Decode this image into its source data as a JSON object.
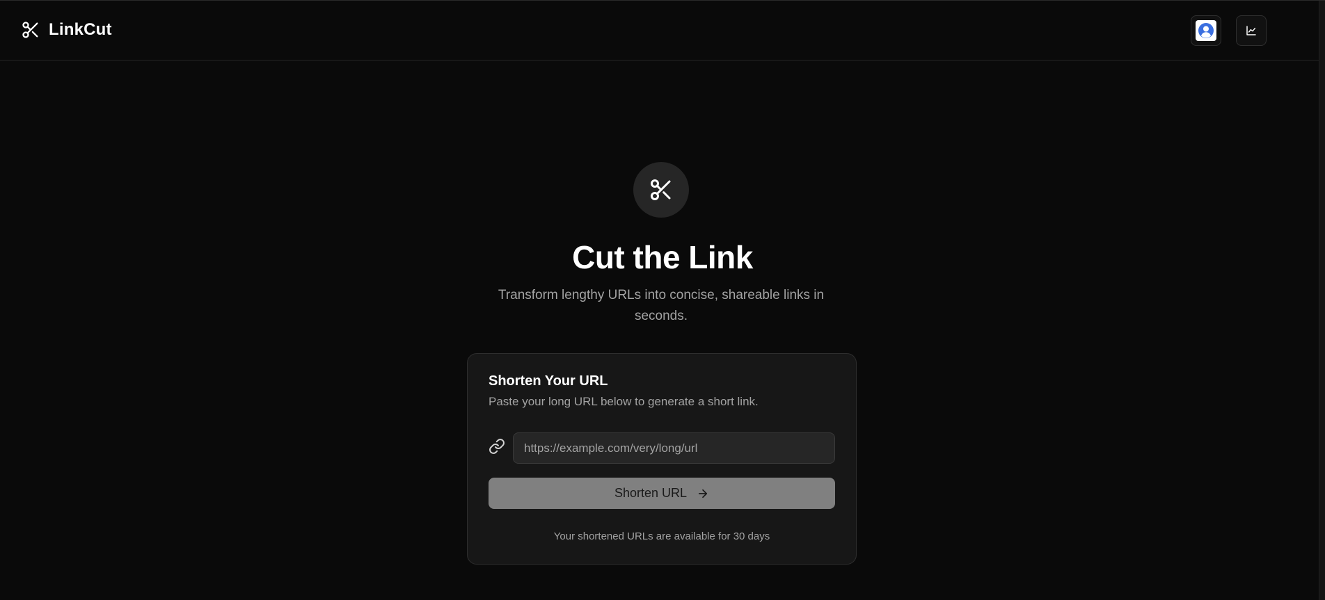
{
  "header": {
    "brand_name": "LinkCut",
    "brand_icon": "scissors-icon",
    "profile_icon": "user-avatar-icon",
    "stats_icon": "chart-icon"
  },
  "hero": {
    "icon": "scissors-icon",
    "title": "Cut the Link",
    "subtitle": "Transform lengthy URLs into concise, shareable links in seconds."
  },
  "card": {
    "title": "Shorten Your URL",
    "description": "Paste your long URL below to generate a short link.",
    "input_icon": "link-icon",
    "input_value": "",
    "input_placeholder": "https://example.com/very/long/url",
    "button_label": "Shorten URL",
    "button_icon": "arrow-right-icon",
    "footnote": "Your shortened URLs are available for 30 days"
  },
  "colors": {
    "background": "#0a0a0a",
    "card_background": "#171717",
    "button_disabled": "#808080",
    "avatar_accent": "#3b6fe0",
    "text_muted": "#a3a3a3"
  }
}
